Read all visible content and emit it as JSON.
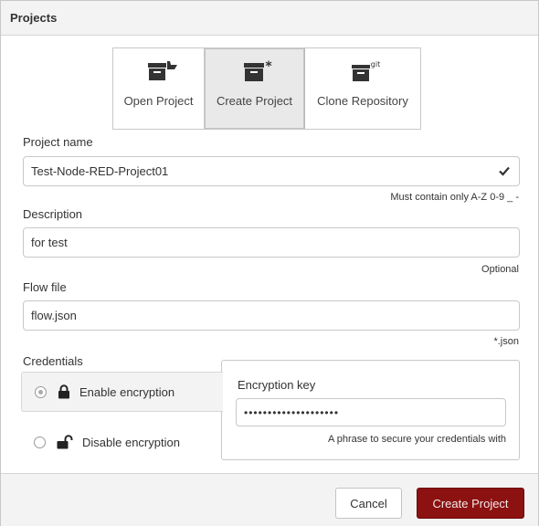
{
  "dialog": {
    "title": "Projects"
  },
  "project_types": [
    {
      "label": "Open Project",
      "icon": "folder-open-icon",
      "selected": false
    },
    {
      "label": "Create Project",
      "icon": "box-star-icon",
      "selected": true
    },
    {
      "label": "Clone Repository",
      "icon": "box-git-icon",
      "selected": false
    }
  ],
  "icon_badges": {
    "git": "git"
  },
  "project_name": {
    "label": "Project name",
    "value": "Test-Node-RED-Project01",
    "hint": "Must contain only A-Z 0-9 _ -"
  },
  "description": {
    "label": "Description",
    "value": "for test",
    "hint": "Optional"
  },
  "flow_file": {
    "label": "Flow file",
    "value": "flow.json",
    "hint": "*.json"
  },
  "credentials": {
    "label": "Credentials",
    "enable_label": "Enable encryption",
    "disable_label": "Disable encryption",
    "selected": "enable",
    "key_label": "Encryption key",
    "key_value": "••••••••••••••••••••",
    "key_hint": "A phrase to secure your credentials with"
  },
  "footer": {
    "cancel_label": "Cancel",
    "create_label": "Create Project"
  },
  "colors": {
    "primary_button": "#8c1111",
    "selected_tab": "#e9e9e9",
    "titlebar": "#f3f3f3"
  }
}
